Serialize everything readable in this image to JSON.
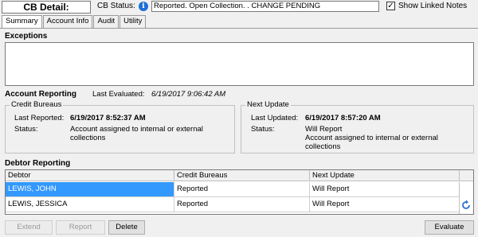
{
  "header": {
    "title": "CB Detail:",
    "status_label": "CB Status:",
    "status_value": "Reported. Open Collection. . CHANGE PENDING",
    "show_linked_notes_label": "Show Linked Notes",
    "show_linked_notes_checked": true,
    "info_icon": "info-icon"
  },
  "tabs": [
    {
      "label": "Summary",
      "active": true
    },
    {
      "label": "Account Info",
      "active": false
    },
    {
      "label": "Audit",
      "active": false
    },
    {
      "label": "Utility",
      "active": false
    }
  ],
  "exceptions": {
    "title": "Exceptions",
    "text": ""
  },
  "account_reporting": {
    "title": "Account Reporting",
    "last_evaluated_label": "Last Evaluated:",
    "last_evaluated_value": "6/19/2017 9:06:42 AM",
    "credit_bureaus": {
      "legend": "Credit Bureaus",
      "last_reported_label": "Last Reported:",
      "last_reported_value": "6/19/2017 8:52:37 AM",
      "status_label": "Status:",
      "status_value": "Account assigned to internal or external collections"
    },
    "next_update": {
      "legend": "Next Update",
      "last_updated_label": "Last Updated:",
      "last_updated_value": "6/19/2017 8:57:20 AM",
      "status_label": "Status:",
      "status_line1": "Will Report",
      "status_line2": "Account assigned to internal or external collections"
    }
  },
  "debtor_reporting": {
    "title": "Debtor Reporting",
    "columns": [
      "Debtor",
      "Credit Bureaus",
      "Next Update"
    ],
    "rows": [
      {
        "debtor": "LEWIS, JOHN",
        "credit_bureaus": "Reported",
        "next_update": "Will Report",
        "selected": true
      },
      {
        "debtor": "LEWIS, JESSICA",
        "credit_bureaus": "Reported",
        "next_update": "Will Report",
        "selected": false
      }
    ]
  },
  "buttons": {
    "extend": "Extend",
    "report": "Report",
    "delete": "Delete",
    "evaluate": "Evaluate",
    "extend_enabled": false,
    "report_enabled": false
  },
  "colors": {
    "selection": "#3399ff",
    "info_icon": "#1f6fd6",
    "window_bg": "#f0f0f0"
  }
}
